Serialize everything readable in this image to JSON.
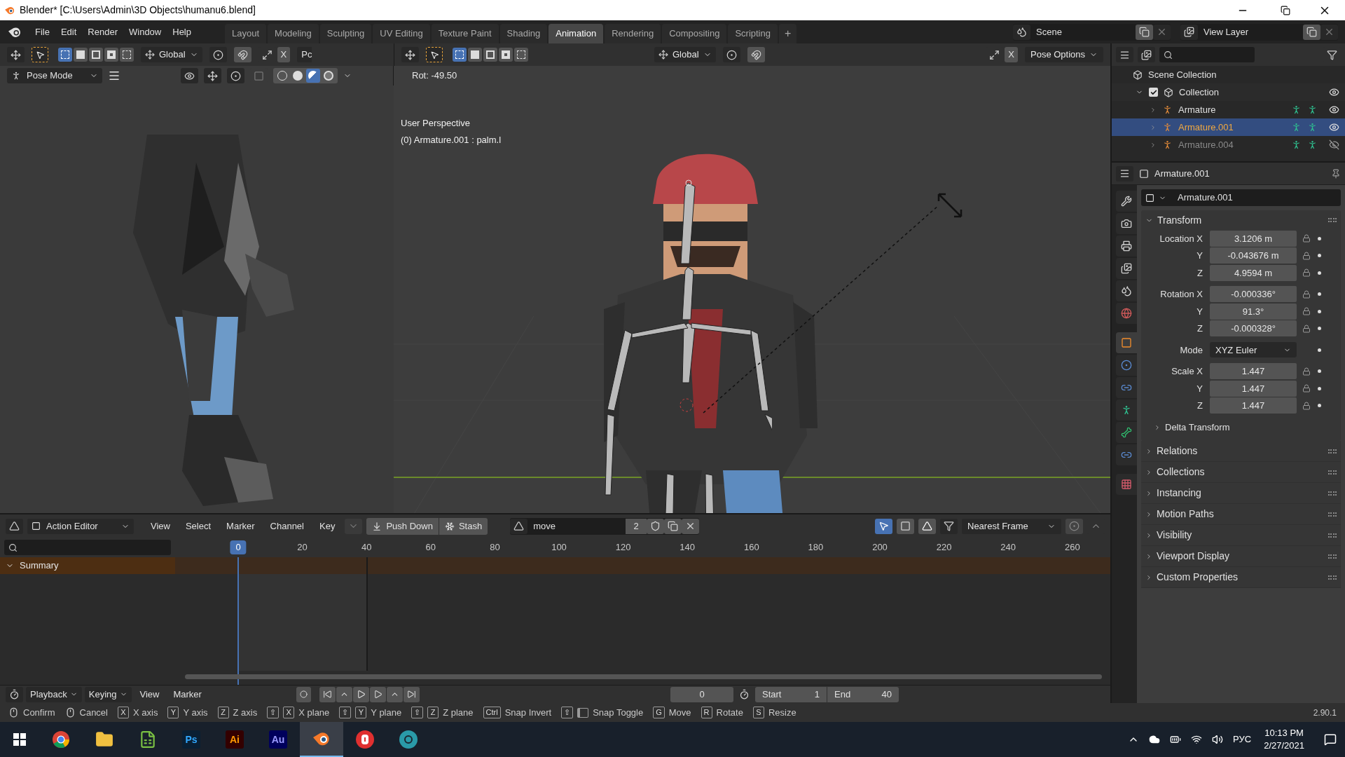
{
  "window": {
    "title": "Blender* [C:\\Users\\Admin\\3D Objects\\humanu6.blend]"
  },
  "menu": [
    "File",
    "Edit",
    "Render",
    "Window",
    "Help"
  ],
  "workspaces": [
    {
      "label": "Layout",
      "selected": false
    },
    {
      "label": "Modeling",
      "selected": false
    },
    {
      "label": "Sculpting",
      "selected": false
    },
    {
      "label": "UV Editing",
      "selected": false
    },
    {
      "label": "Texture Paint",
      "selected": false
    },
    {
      "label": "Shading",
      "selected": false
    },
    {
      "label": "Animation",
      "selected": true
    },
    {
      "label": "Rendering",
      "selected": false
    },
    {
      "label": "Compositing",
      "selected": false
    },
    {
      "label": "Scripting",
      "selected": false
    }
  ],
  "add_workspace": "+",
  "scene": "Scene",
  "view_layer": "View Layer",
  "left_viewport": {
    "orientation": "Global",
    "xray_label": "X",
    "cut_label": "Pc",
    "mode": "Pose Mode",
    "shading": [
      {
        "kind": "wireframe",
        "selected": false
      },
      {
        "kind": "solid",
        "selected": false
      },
      {
        "kind": "material",
        "selected": true
      },
      {
        "kind": "rendered",
        "selected": false
      }
    ]
  },
  "main_viewport": {
    "orientation": "Global",
    "xray_label": "X",
    "options": "Pose Options",
    "readout": "Rot: -49.50",
    "view_name": "User Perspective",
    "active_item": "(0) Armature.001 : palm.l"
  },
  "outliner": {
    "root": "Scene Collection",
    "collections": [
      {
        "label": "Collection",
        "checked": true,
        "expanded": true,
        "children": [
          {
            "label": "Armature",
            "selected": false,
            "visible": true
          },
          {
            "label": "Armature.001",
            "selected": true,
            "visible": true
          },
          {
            "label": "Armature.004",
            "selected": false,
            "visible": false
          }
        ]
      }
    ]
  },
  "properties": {
    "object_name": "Armature.001",
    "datablock": "Armature.001",
    "tabs": [
      {
        "kind": "tool",
        "selected": false
      },
      {
        "kind": "render",
        "selected": false
      },
      {
        "kind": "output",
        "selected": false
      },
      {
        "kind": "view_layer",
        "selected": false
      },
      {
        "kind": "scene",
        "selected": false
      },
      {
        "kind": "world",
        "selected": false
      },
      {
        "kind": "object",
        "selected": true
      },
      {
        "kind": "physics",
        "selected": false
      },
      {
        "kind": "constraints",
        "selected": false
      },
      {
        "kind": "data",
        "selected": false
      },
      {
        "kind": "bone",
        "selected": false
      },
      {
        "kind": "bone_constraints",
        "selected": false
      },
      {
        "kind": "texture",
        "selected": false
      }
    ],
    "transform": {
      "title": "Transform",
      "expanded": true,
      "groups": [
        {
          "kind": "field",
          "rows": [
            {
              "label": "Location X",
              "value": "3.1206 m"
            },
            {
              "label": "Y",
              "value": "-0.043676 m"
            },
            {
              "label": "Z",
              "value": "4.9594 m"
            }
          ]
        },
        {
          "kind": "field",
          "rows": [
            {
              "label": "Rotation X",
              "value": "-0.000336°"
            },
            {
              "label": "Y",
              "value": "91.3°"
            },
            {
              "label": "Z",
              "value": "-0.000328°"
            }
          ]
        },
        {
          "kind": "dropdown",
          "rows": [
            {
              "label": "Mode",
              "value": "XYZ Euler"
            }
          ]
        },
        {
          "kind": "field",
          "rows": [
            {
              "label": "Scale X",
              "value": "1.447"
            },
            {
              "label": "Y",
              "value": "1.447"
            },
            {
              "label": "Z",
              "value": "1.447"
            }
          ]
        }
      ],
      "delta": {
        "label": "Delta Transform",
        "expanded": false
      }
    },
    "panels": [
      {
        "label": "Relations",
        "expanded": false
      },
      {
        "label": "Collections",
        "expanded": false
      },
      {
        "label": "Instancing",
        "expanded": false
      },
      {
        "label": "Motion Paths",
        "expanded": false
      },
      {
        "label": "Visibility",
        "expanded": false
      },
      {
        "label": "Viewport Display",
        "expanded": false
      },
      {
        "label": "Custom Properties",
        "expanded": false
      }
    ]
  },
  "action_editor": {
    "mode": "Action Editor",
    "menus": [
      "View",
      "Select",
      "Marker",
      "Channel",
      "Key"
    ],
    "push_down": "Push Down",
    "stash": "Stash",
    "action": "move",
    "users": "2",
    "snap": "Nearest Frame",
    "ruler": [
      {
        "label": "0",
        "selected": true
      },
      {
        "label": "20",
        "selected": false
      },
      {
        "label": "40",
        "selected": false
      },
      {
        "label": "60",
        "selected": false
      },
      {
        "label": "80",
        "selected": false
      },
      {
        "label": "100",
        "selected": false
      },
      {
        "label": "120",
        "selected": false
      },
      {
        "label": "140",
        "selected": false
      },
      {
        "label": "160",
        "selected": false
      },
      {
        "label": "180",
        "selected": false
      },
      {
        "label": "200",
        "selected": false
      },
      {
        "label": "220",
        "selected": false
      },
      {
        "label": "240",
        "selected": false
      },
      {
        "label": "260",
        "selected": false
      }
    ],
    "channels": [
      {
        "label": "Summary",
        "expanded": true
      }
    ]
  },
  "timeline": {
    "menus": [
      {
        "label": "Playback",
        "kind": "dropdown"
      },
      {
        "label": "Keying",
        "kind": "dropdown"
      },
      {
        "label": "View",
        "kind": "menu"
      },
      {
        "label": "Marker",
        "kind": "menu"
      }
    ],
    "frame": "0",
    "start_label": "Start",
    "start": "1",
    "end_label": "End",
    "end": "40"
  },
  "status_bar": {
    "hints": [
      {
        "kind": "mouse",
        "label": "Confirm"
      },
      {
        "kind": "mouse",
        "label": "Cancel"
      },
      {
        "keys": [
          "X"
        ],
        "label": "X axis"
      },
      {
        "keys": [
          "Y"
        ],
        "label": "Y axis"
      },
      {
        "keys": [
          "Z"
        ],
        "label": "Z axis"
      },
      {
        "keys": [
          "⇧",
          "X"
        ],
        "label": "X plane"
      },
      {
        "keys": [
          "⇧",
          "Y"
        ],
        "label": "Y plane"
      },
      {
        "keys": [
          "⇧",
          "Z"
        ],
        "label": "Z plane"
      },
      {
        "keys": [
          "Ctrl"
        ],
        "label": "Snap Invert"
      },
      {
        "keys": [
          "⇧"
        ],
        "kind": "snap",
        "label": "Snap Toggle"
      },
      {
        "keys": [
          "G"
        ],
        "label": "Move"
      },
      {
        "keys": [
          "R"
        ],
        "label": "Rotate"
      },
      {
        "keys": [
          "S"
        ],
        "label": "Resize"
      }
    ],
    "version": "2.90.1"
  },
  "taskbar": {
    "apps": [
      {
        "kind": "chrome",
        "selected": false
      },
      {
        "kind": "files",
        "selected": false
      },
      {
        "kind": "sheet",
        "selected": false
      },
      {
        "kind": "ps",
        "label": "Ps",
        "selected": false
      },
      {
        "kind": "ai",
        "label": "Ai",
        "selected": false
      },
      {
        "kind": "au",
        "label": "Au",
        "selected": false
      },
      {
        "kind": "blender",
        "selected": true
      },
      {
        "kind": "substance",
        "selected": false
      },
      {
        "kind": "app",
        "selected": false
      }
    ],
    "language": "РУС",
    "time": "10:13 PM",
    "date": "2/27/2021"
  }
}
